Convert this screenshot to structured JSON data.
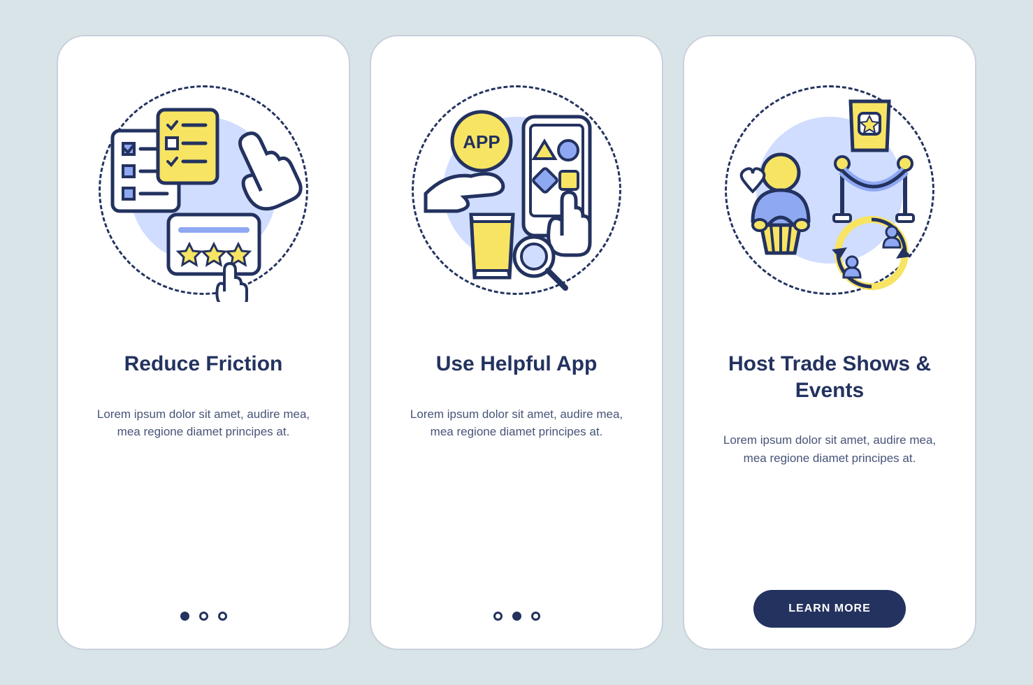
{
  "cards": [
    {
      "title": "Reduce Friction",
      "description": "Lorem ipsum dolor sit amet, audire mea, mea regione diamet principes at."
    },
    {
      "title": "Use Helpful App",
      "description": "Lorem ipsum dolor sit amet, audire mea, mea regione diamet principes at."
    },
    {
      "title": "Host Trade Shows & Events",
      "description": "Lorem ipsum dolor sit amet, audire mea, mea regione diamet principes at."
    }
  ],
  "cta_label": "LEARN MORE",
  "colors": {
    "background": "#d9e4e9",
    "card_bg": "#ffffff",
    "card_border": "#c9d0db",
    "primary_dark": "#23325f",
    "accent_yellow": "#f7e463",
    "accent_blue": "#8fa8f2",
    "light_blue": "#d0ddff"
  },
  "icon_label": "APP"
}
